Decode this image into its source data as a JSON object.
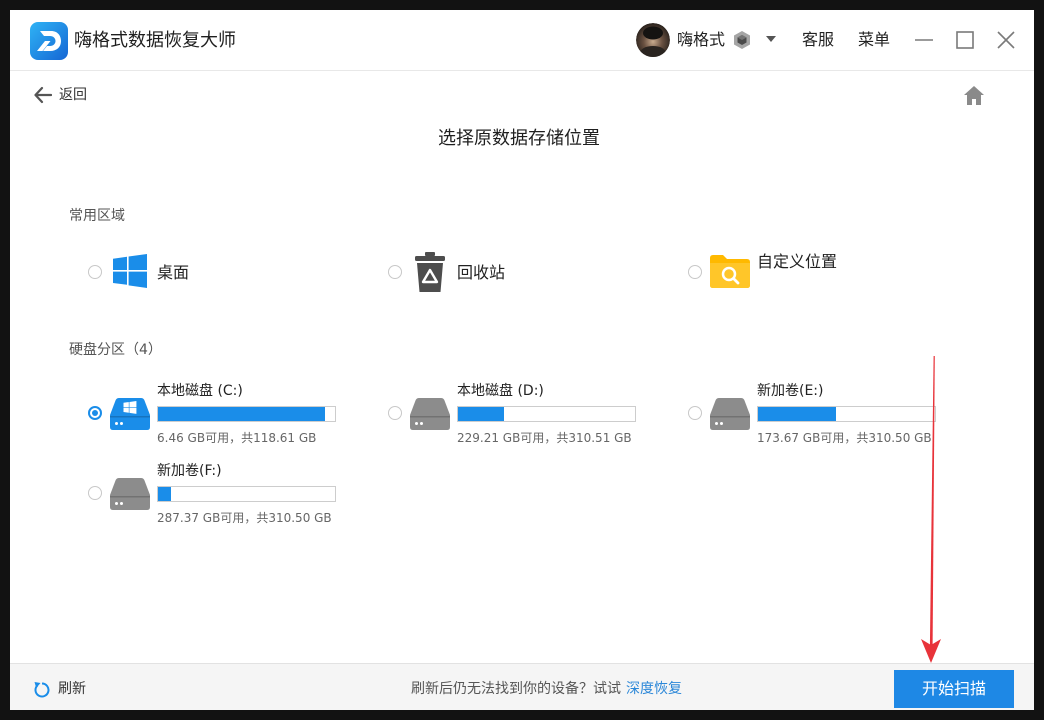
{
  "app": {
    "title": "嗨格式数据恢复大师",
    "logo_icon": "app-logo-icon"
  },
  "header": {
    "avatar_icon": "user-avatar",
    "username": "嗨格式",
    "badge_icon": "vip-badge-icon",
    "support_label": "客服",
    "menu_label": "菜单"
  },
  "nav": {
    "back_label": "返回",
    "home_icon": "home-icon"
  },
  "main": {
    "title": "选择原数据存储位置",
    "common_section": {
      "label": "常用区域",
      "items": [
        {
          "label": "桌面",
          "icon": "windows-icon",
          "selected": false
        },
        {
          "label": "回收站",
          "icon": "recycle-bin-icon",
          "selected": false
        },
        {
          "label": "自定义位置",
          "icon": "folder-search-icon",
          "selected": false
        }
      ]
    },
    "disk_section": {
      "label": "硬盘分区（4）",
      "disks": [
        {
          "label": "本地磁盘 (C:)",
          "usage": "6.46 GB可用，共118.61 GB",
          "used_fraction": 0.946,
          "icon": "system-drive-icon",
          "selected": true
        },
        {
          "label": "本地磁盘 (D:)",
          "usage": "229.21 GB可用，共310.51 GB",
          "used_fraction": 0.262,
          "icon": "drive-icon",
          "selected": false
        },
        {
          "label": "新加卷(E:)",
          "usage": "173.67 GB可用，共310.50 GB",
          "used_fraction": 0.441,
          "icon": "drive-icon",
          "selected": false
        },
        {
          "label": "新加卷(F:)",
          "usage": "287.37 GB可用，共310.50 GB",
          "used_fraction": 0.074,
          "icon": "drive-icon",
          "selected": false
        }
      ]
    }
  },
  "footer": {
    "refresh_label": "刷新",
    "hint": "刷新后仍无法找到你的设备？试试",
    "deep_recovery_link": "深度恢复",
    "start_scan_label": "开始扫描"
  },
  "colors": {
    "accent": "#1a8de9",
    "button": "#1e88e5",
    "link": "#2b87d8",
    "drive": "#8c8c8c",
    "folder": "#ffb900",
    "annotation": "#e8333a"
  }
}
